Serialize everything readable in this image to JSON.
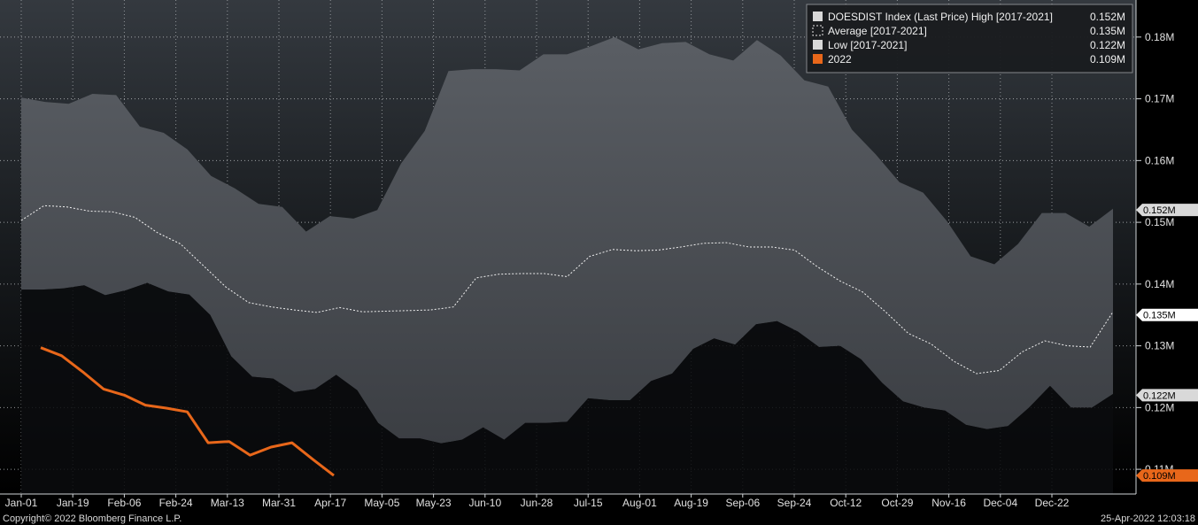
{
  "chart_data": {
    "type": "area",
    "x": [
      "Jan-01",
      "Jan-10",
      "Jan-19",
      "Jan-28",
      "Feb-06",
      "Feb-15",
      "Feb-24",
      "Mar-05",
      "Mar-13",
      "Mar-22",
      "Mar-31",
      "Apr-08",
      "Apr-17",
      "Apr-26",
      "May-05",
      "May-14",
      "May-23",
      "Jun-01",
      "Jun-10",
      "Jun-19",
      "Jun-28",
      "Jul-06",
      "Jul-15",
      "Jul-24",
      "Aug-01",
      "Aug-10",
      "Aug-19",
      "Aug-28",
      "Sep-06",
      "Sep-15",
      "Sep-24",
      "Oct-03",
      "Oct-12",
      "Oct-21",
      "Oct-29",
      "Nov-07",
      "Nov-16",
      "Nov-25",
      "Dec-04",
      "Dec-13",
      "Dec-22",
      "Dec-31"
    ],
    "xtick_labels": [
      "Jan-01",
      "Jan-19",
      "Feb-06",
      "Feb-24",
      "Mar-13",
      "Mar-31",
      "Apr-17",
      "May-05",
      "May-23",
      "Jun-10",
      "Jun-28",
      "Jul-15",
      "Aug-01",
      "Aug-19",
      "Sep-06",
      "Sep-24",
      "Oct-12",
      "Oct-29",
      "Nov-16",
      "Dec-04",
      "Dec-22"
    ],
    "yticks": [
      "0.11M",
      "0.12M",
      "0.13M",
      "0.14M",
      "0.15M",
      "0.16M",
      "0.17M",
      "0.18M"
    ],
    "ytick_values": [
      0.11,
      0.12,
      0.13,
      0.14,
      0.15,
      0.16,
      0.17,
      0.18
    ],
    "ylim": [
      0.106,
      0.186
    ],
    "series": [
      {
        "name": "DOESDIST Index (Last Price) High [2017-2021]",
        "last": "0.152M",
        "color": "#4a4d52",
        "legend_color": "#d8d8d8",
        "values": [
          0.1702,
          0.1695,
          0.1692,
          0.1708,
          0.1706,
          0.1655,
          0.1645,
          0.1618,
          0.1575,
          0.1555,
          0.153,
          0.1525,
          0.1485,
          0.151,
          0.1506,
          0.152,
          0.1595,
          0.1648,
          0.1745,
          0.1748,
          0.1748,
          0.1746,
          0.1772,
          0.1772,
          0.1785,
          0.18,
          0.178,
          0.179,
          0.1792,
          0.1772,
          0.1762,
          0.1795,
          0.177,
          0.173,
          0.172,
          0.165,
          0.161,
          0.1565,
          0.1548,
          0.1502,
          0.1445,
          0.1432,
          0.1465,
          0.1515,
          0.1515,
          0.1493,
          0.1522
        ]
      },
      {
        "name": "Average  [2017-2021]",
        "last": "0.135M",
        "color": "#e8e8e8",
        "dashed": true,
        "values": [
          0.1503,
          0.1527,
          0.1525,
          0.1518,
          0.1517,
          0.1508,
          0.1483,
          0.1465,
          0.143,
          0.1395,
          0.137,
          0.1363,
          0.1358,
          0.1354,
          0.1362,
          0.1355,
          0.1356,
          0.1357,
          0.1358,
          0.1363,
          0.141,
          0.1416,
          0.1417,
          0.1417,
          0.1412,
          0.1445,
          0.1456,
          0.1454,
          0.1455,
          0.146,
          0.1466,
          0.1467,
          0.146,
          0.146,
          0.1455,
          0.1428,
          0.1405,
          0.1387,
          0.1355,
          0.132,
          0.1303,
          0.1275,
          0.1255,
          0.126,
          0.129,
          0.1308,
          0.13,
          0.1298,
          0.1355
        ]
      },
      {
        "name": "Low  [2017-2021]",
        "last": "0.122M",
        "color": "#0d0e10",
        "legend_color": "#d8d8d8",
        "values": [
          0.1391,
          0.1391,
          0.1393,
          0.1398,
          0.1382,
          0.139,
          0.1402,
          0.1388,
          0.1383,
          0.135,
          0.1283,
          0.125,
          0.1247,
          0.1225,
          0.123,
          0.1253,
          0.1228,
          0.1175,
          0.115,
          0.115,
          0.1142,
          0.1148,
          0.1168,
          0.1148,
          0.1175,
          0.1175,
          0.1177,
          0.1215,
          0.1212,
          0.1212,
          0.1243,
          0.1255,
          0.1295,
          0.1312,
          0.1302,
          0.1335,
          0.134,
          0.1323,
          0.1298,
          0.13,
          0.1278,
          0.124,
          0.121,
          0.12,
          0.1195,
          0.1172,
          0.1165,
          0.117,
          0.12,
          0.1235,
          0.12,
          0.12,
          0.1222
        ]
      },
      {
        "name": "2022",
        "last": "0.109M",
        "color": "#e8671a",
        "legend_color": "#e8671a",
        "values": [
          0.1297,
          0.1284,
          0.1258,
          0.123,
          0.122,
          0.1204,
          0.1199,
          0.1193,
          0.1143,
          0.1145,
          0.1123,
          0.1136,
          0.1143,
          0.1116,
          0.109
        ]
      }
    ],
    "grid": true,
    "legend_placement": "top-right"
  },
  "footer": {
    "copyright": "Copyright© 2022 Bloomberg Finance L.P.",
    "timestamp": "25-Apr-2022 12:03:18"
  }
}
